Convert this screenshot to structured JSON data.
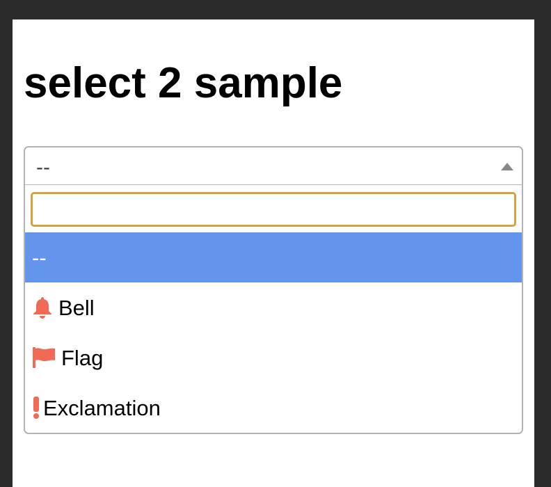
{
  "page": {
    "title": "select 2 sample"
  },
  "select": {
    "selected_text": "--",
    "search": {
      "value": "",
      "placeholder": ""
    },
    "options": [
      {
        "label": "--",
        "icon": null,
        "highlighted": true
      },
      {
        "label": "Bell",
        "icon": "bell-icon",
        "highlighted": false
      },
      {
        "label": "Flag",
        "icon": "flag-icon",
        "highlighted": false
      },
      {
        "label": "Exclamation",
        "icon": "exclamation-icon",
        "highlighted": false
      }
    ]
  },
  "colors": {
    "highlight": "#6495ed",
    "icon": "#f06a55",
    "search_border": "#d6a040",
    "background_frame": "#2b2b2b"
  }
}
